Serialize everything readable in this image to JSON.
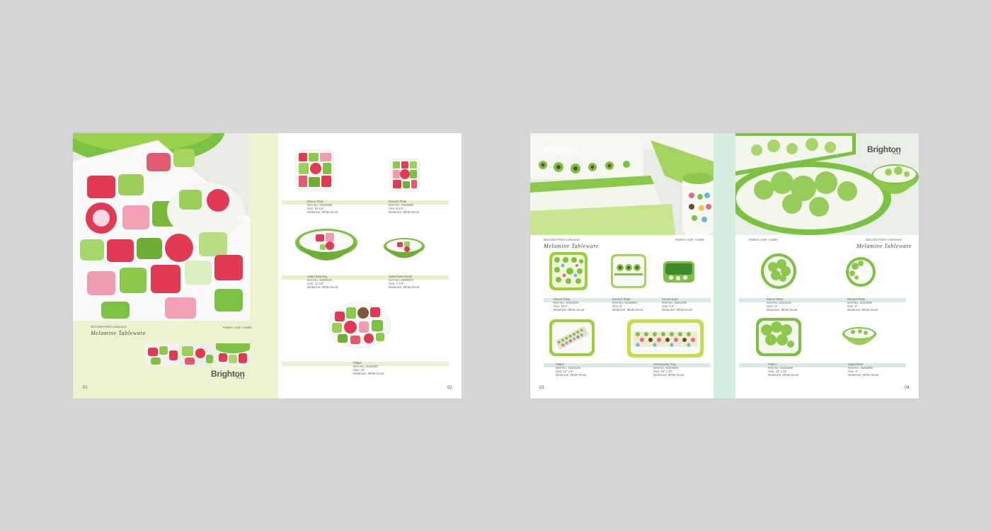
{
  "spread1": {
    "collection_label": "DECORATION colections",
    "title": "Melamine Tableware",
    "pattern_code": "Pattern code: A1892",
    "brand": "Brighton",
    "brand_sub": "PLUS",
    "page_left": "01",
    "page_right": "02",
    "products": [
      {
        "name": "Dinner Plate",
        "item": "Item No.: B165105",
        "size": "Size: 10-1/4\"",
        "material": "Melamine: White Decal"
      },
      {
        "name": "Dessert Plate",
        "item": "Item No.: B165080",
        "size": "Size: 8-1/2\"",
        "material": "Melamine: White Decal"
      },
      {
        "name": "Salad Bowl Big",
        "item": "Item No.: B250118",
        "size": "Size: 11-3/4\"",
        "material": "Melamine: White Decal"
      },
      {
        "name": "Salad Bowl Small",
        "item": "Item No.: B300070",
        "size": "Size: 7-1/4\"",
        "material": "Melamine: White Decal"
      },
      {
        "name": "Platter",
        "item": "Item No.: B161180",
        "size": "Size: 16\"",
        "material": "Melamine: White Decal"
      }
    ]
  },
  "spread2": {
    "brand": "Brighton",
    "brand_sub": "PLUS",
    "left": {
      "collection_label": "DECORATION colections",
      "title": "Melamine Tableware",
      "pattern_code": "Pattern code: A1886",
      "page": "03",
      "products": [
        {
          "name": "Dinner Plate",
          "item": "Item No.: B152105",
          "size": "Size: 10.5\"",
          "material": "Melamine: White Decal"
        },
        {
          "name": "Dessert Plate",
          "item": "Item No.: B152080",
          "size": "Size: 8\"",
          "material": "Melamine: White Decal"
        },
        {
          "name": "Cereal Bowl",
          "item": "Item No.: B251095",
          "size": "Size: 5.5\"",
          "material": "Melamine: White Decal"
        },
        {
          "name": "Platter",
          "item": "Item No.: B155125",
          "size": "Size: 12\" x 8\"",
          "material": "Melamine: White Decal"
        },
        {
          "name": "Rectangular Tray",
          "item": "Item No.: B154160",
          "size": "Size: 16\" x 10\"",
          "material": "Melamine: White Decal"
        }
      ]
    },
    "right": {
      "collection_label": "DECORATION colections",
      "title": "Melamine Tableware",
      "pattern_code": "Pattern code: A1885",
      "page": "04",
      "products": [
        {
          "name": "Dinner Plate",
          "item": "Item No.: B124119",
          "size": "Size: 11\"",
          "material": "Melamine: White Decal"
        },
        {
          "name": "Dessert Plate",
          "item": "Item No.: B124090",
          "size": "Size: 9\"",
          "material": "Melamine: White Decal"
        },
        {
          "name": "Platter",
          "item": "Item No.: B153168",
          "size": "Size: 16\" x 12\"",
          "material": "Melamine: White Decal"
        },
        {
          "name": "Salad Bowl",
          "item": "Item No.: B252090",
          "size": "Size: 6\"",
          "material": "Melamine: White Decal"
        }
      ]
    }
  },
  "colors": {
    "background": "#d6d6d6",
    "lime_panel": "#eef3cf",
    "mint_panel": "#d6ece0",
    "accent_green": "#7cc242",
    "accent_red": "#e23a55"
  }
}
